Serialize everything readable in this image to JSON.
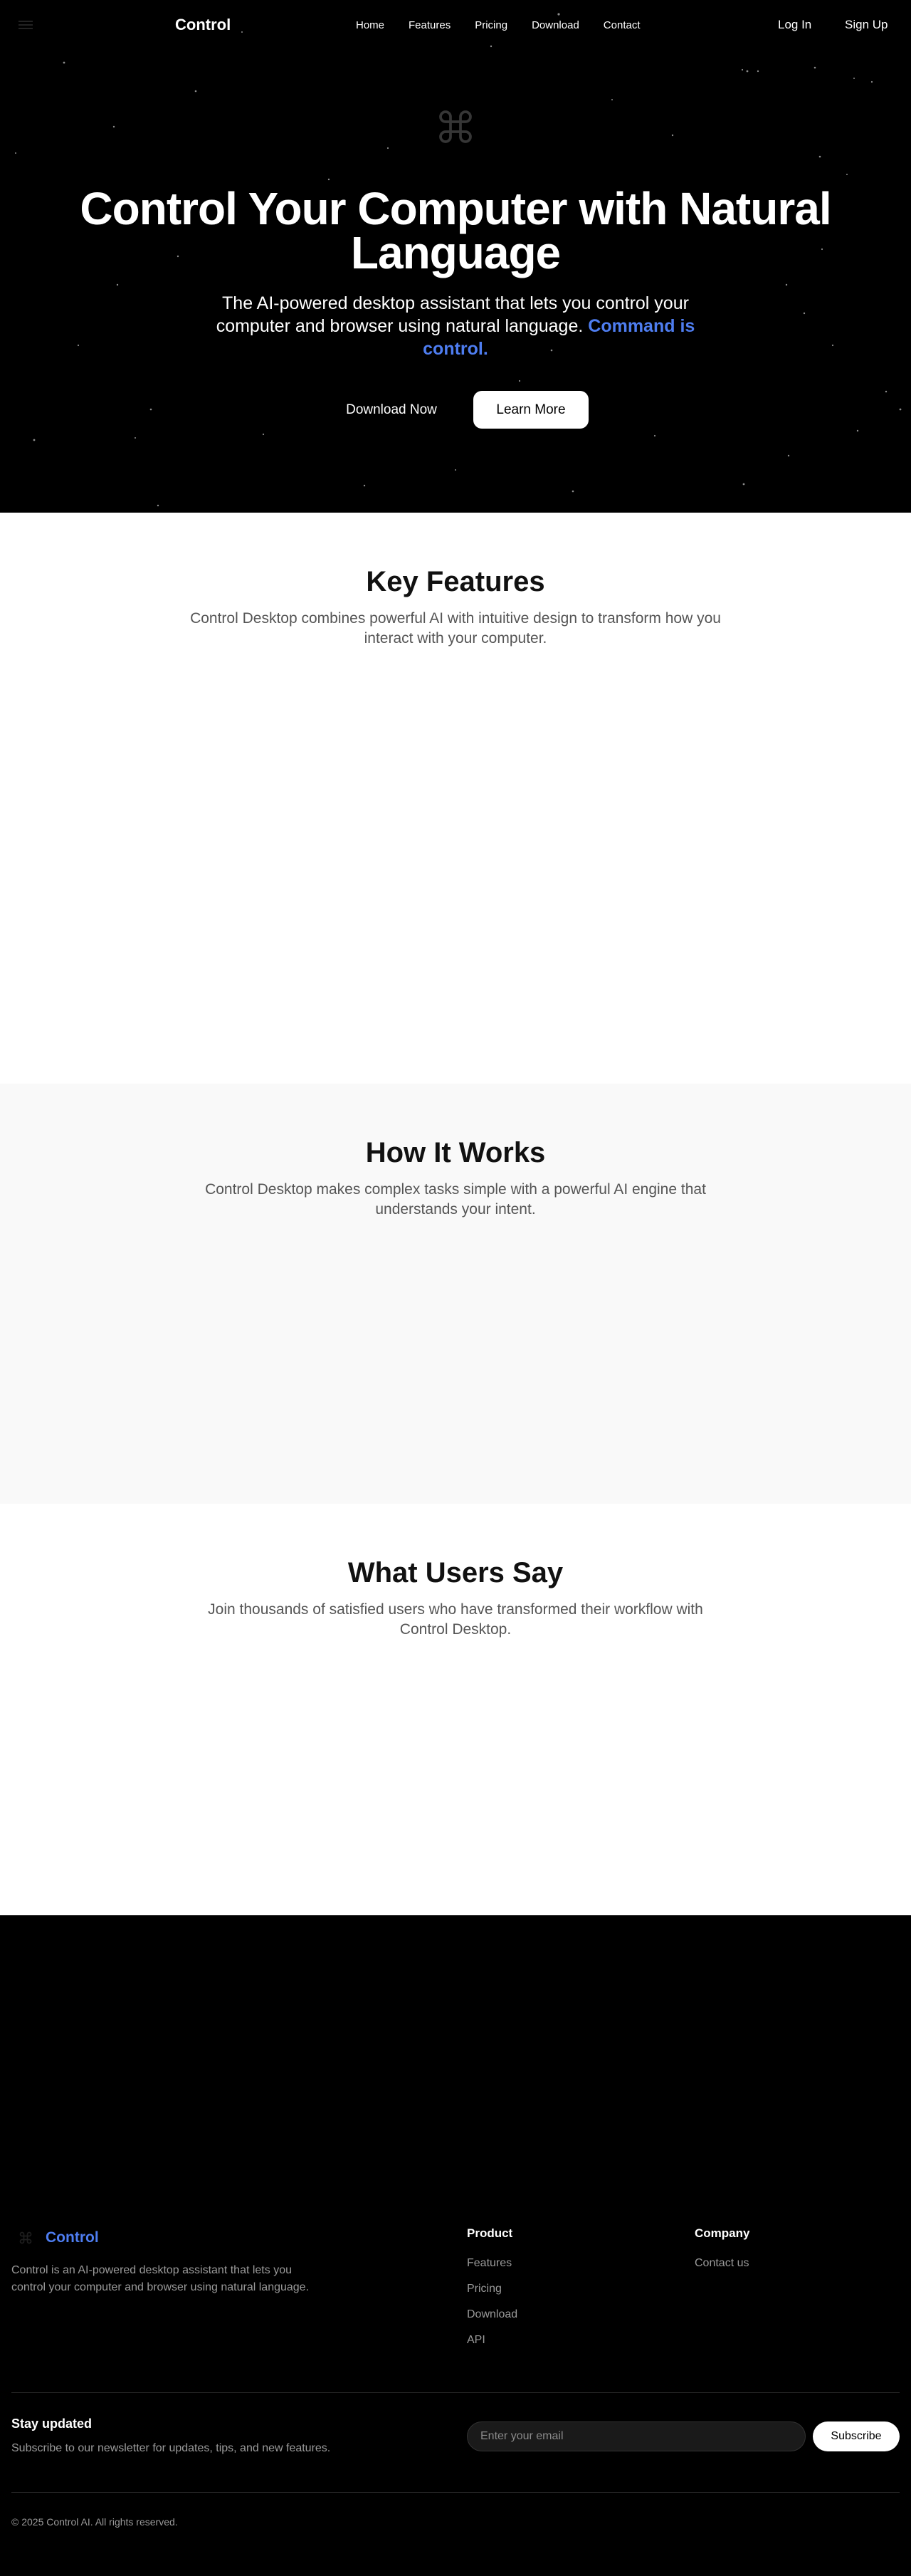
{
  "nav": {
    "brand": "Control",
    "links": [
      "Home",
      "Features",
      "Pricing",
      "Download",
      "Contact"
    ],
    "login": "Log In",
    "signup": "Sign Up"
  },
  "hero": {
    "title": "Control Your Computer with Natural Language",
    "subtitle": "The AI-powered desktop assistant that lets you control your computer and browser using natural language.",
    "subtitle_accent": "Command is control.",
    "primary_button": "Download Now",
    "secondary_button": "Learn More",
    "icon": "command-icon"
  },
  "features": {
    "title": "Key Features",
    "description": "Control Desktop combines powerful AI with intuitive design to transform how you interact with your computer."
  },
  "how": {
    "title": "How It Works",
    "description": "Control Desktop makes complex tasks simple with a powerful AI engine that understands your intent."
  },
  "users": {
    "title": "What Users Say",
    "description": "Join thousands of satisfied users who have transformed their workflow with Control Desktop."
  },
  "footer": {
    "brand": "Control",
    "about": "Control is an AI-powered desktop assistant that lets you control your computer and browser using natural language.",
    "product_head": "Product",
    "product_links": [
      "Features",
      "Pricing",
      "Download",
      "API"
    ],
    "company_head": "Company",
    "company_links": [
      "Contact us"
    ],
    "newsletter_title": "Stay updated",
    "newsletter_desc": "Subscribe to our newsletter for updates, tips, and new features.",
    "email_placeholder": "Enter your email",
    "subscribe": "Subscribe",
    "copyright": "© 2025 Control AI. All rights reserved."
  },
  "colors": {
    "accent": "#4e7df0",
    "hero_bg": "#000000",
    "muted_text": "#9a9a9a"
  }
}
